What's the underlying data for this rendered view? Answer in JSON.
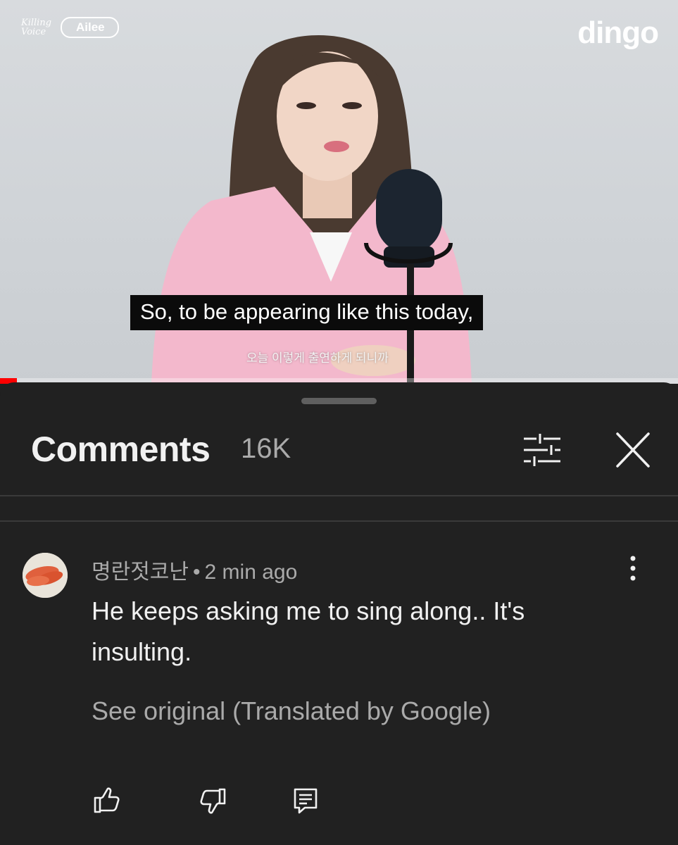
{
  "video": {
    "channel_logo_script": "Killing Voice",
    "channel_logo_name": "Ailee",
    "brand_logo": "dingo",
    "subtitle_en": "So, to be appearing like this today,",
    "subtitle_ko": "오늘 이렇게 출연하게 되니까",
    "progress_fraction": 0.025,
    "colors": {
      "progress_played": "#ff0000",
      "jacket": "#f3b8cc"
    }
  },
  "comments_panel": {
    "title": "Comments",
    "count": "16K",
    "filter_icon": "filter-sliders-icon",
    "close_icon": "close-icon",
    "background": "#212121"
  },
  "comment": {
    "author": "명란젓코난",
    "separator": "•",
    "time": "2 min ago",
    "text": "He keeps asking me to sing along.. It's insulting.",
    "translation_link": "See original (Translated by Google)",
    "menu_icon": "more-vertical-icon",
    "actions": [
      "like-icon",
      "dislike-icon",
      "reply-icon"
    ]
  }
}
